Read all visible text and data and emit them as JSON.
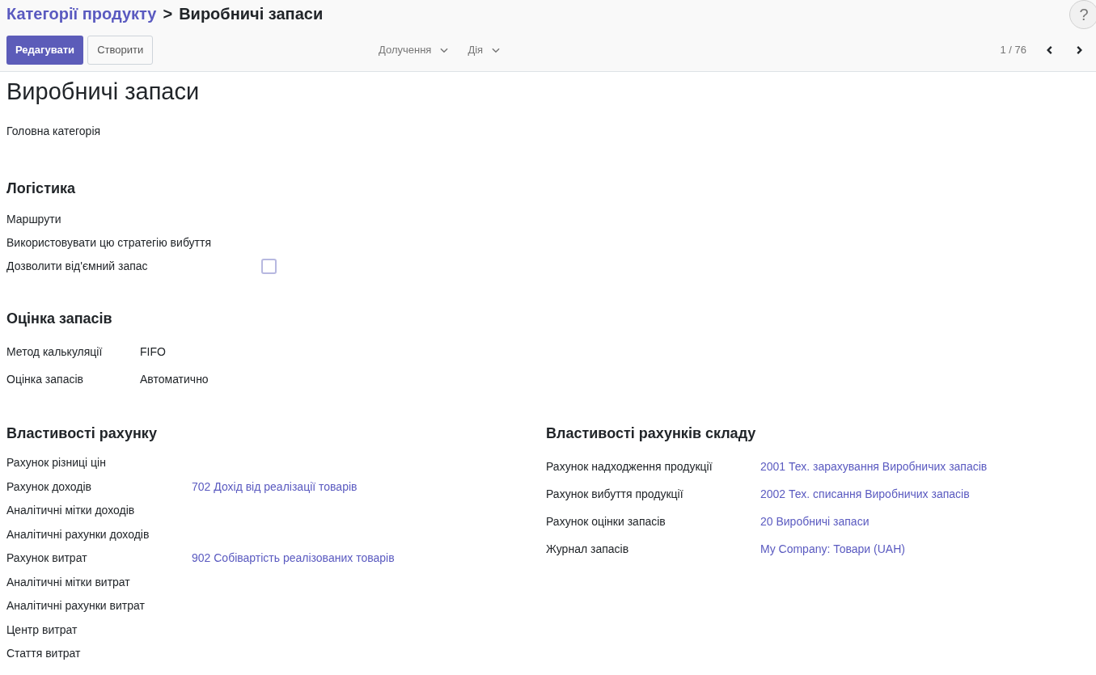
{
  "breadcrumb": {
    "parent": "Категорії продукту",
    "separator": ">",
    "current": "Виробничі запаси"
  },
  "help": "?",
  "buttons": [
    {
      "label": "Редагувати",
      "kind": "primary"
    },
    {
      "label": "Створити",
      "kind": "secondary"
    }
  ],
  "menus": [
    "Долучення",
    "Дія"
  ],
  "pager": {
    "text": "1 / 76"
  },
  "title": "Виробничі запаси",
  "parent_field": {
    "label": "Головна категорія"
  },
  "logistics": {
    "heading": "Логістика",
    "fields": [
      {
        "label": "Маршрути",
        "kind": "empty"
      },
      {
        "label": "Використовувати цю стратегію вибуття",
        "kind": "empty"
      },
      {
        "label": "Дозволити від'ємний запас",
        "kind": "checkbox",
        "checked": false
      }
    ]
  },
  "valuation": {
    "heading": "Оцінка запасів",
    "fields": [
      {
        "label": "Метод калькуляції",
        "kind": "text",
        "value": "FIFO"
      },
      {
        "label": "Оцінка запасів",
        "kind": "text",
        "value": "Автоматично"
      }
    ]
  },
  "account_properties": {
    "heading": "Властивості рахунку",
    "fields": [
      {
        "label": "Рахунок різниці цін",
        "kind": "empty"
      },
      {
        "label": "Рахунок доходів",
        "kind": "link",
        "value": "702 Дохід від реалізації товарів"
      },
      {
        "label": "Аналітичні мітки доходів",
        "kind": "empty"
      },
      {
        "label": "Аналітичні рахунки доходів",
        "kind": "empty"
      },
      {
        "label": "Рахунок витрат",
        "kind": "link",
        "value": "902 Собівартість реалізованих товарів"
      },
      {
        "label": "Аналітичні мітки витрат",
        "kind": "empty"
      },
      {
        "label": "Аналітичні рахунки витрат",
        "kind": "empty"
      },
      {
        "label": "Центр витрат",
        "kind": "empty"
      },
      {
        "label": "Стаття витрат",
        "kind": "empty"
      }
    ]
  },
  "stock_accounts": {
    "heading": "Властивості рахунків складу",
    "fields": [
      {
        "label": "Рахунок надходження продукції",
        "kind": "link",
        "value": "2001 Тех. зарахування Виробничих запасів"
      },
      {
        "label": "Рахунок вибуття продукції",
        "kind": "link",
        "value": "2002 Тех. списання Виробничих запасів"
      },
      {
        "label": "Рахунок оцінки запасів",
        "kind": "link",
        "value": "20 Виробничі запаси"
      },
      {
        "label": "Журнал запасів",
        "kind": "link",
        "value": "My Company: Товари (UAH)"
      }
    ]
  }
}
